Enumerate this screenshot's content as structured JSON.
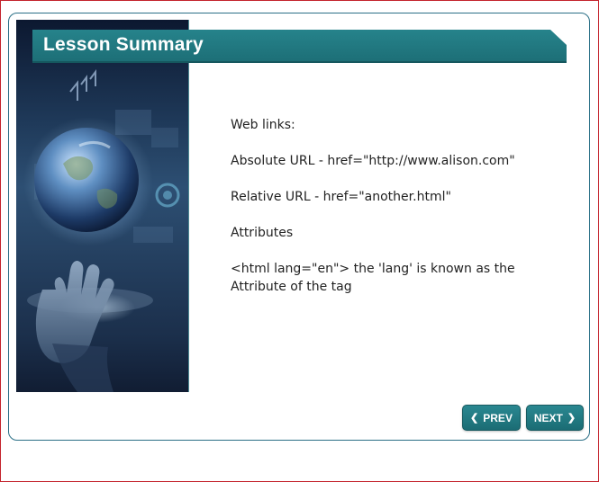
{
  "header": {
    "title": "Lesson Summary"
  },
  "content": {
    "lines": [
      "Web links:",
      "Absolute URL - href=\"http://www.alison.com\"",
      "Relative URL - href=\"another.html\"",
      "Attributes",
      "<html lang=\"en\"> the 'lang' is known as the Attribute of the tag"
    ]
  },
  "nav": {
    "prev_label": "PREV",
    "next_label": "NEXT",
    "prev_icon": "chevron-left-icon",
    "next_icon": "chevron-right-icon"
  },
  "colors": {
    "accent": "#1d6f77",
    "frame_border": "#c4232c",
    "card_border": "#2a6f86"
  }
}
